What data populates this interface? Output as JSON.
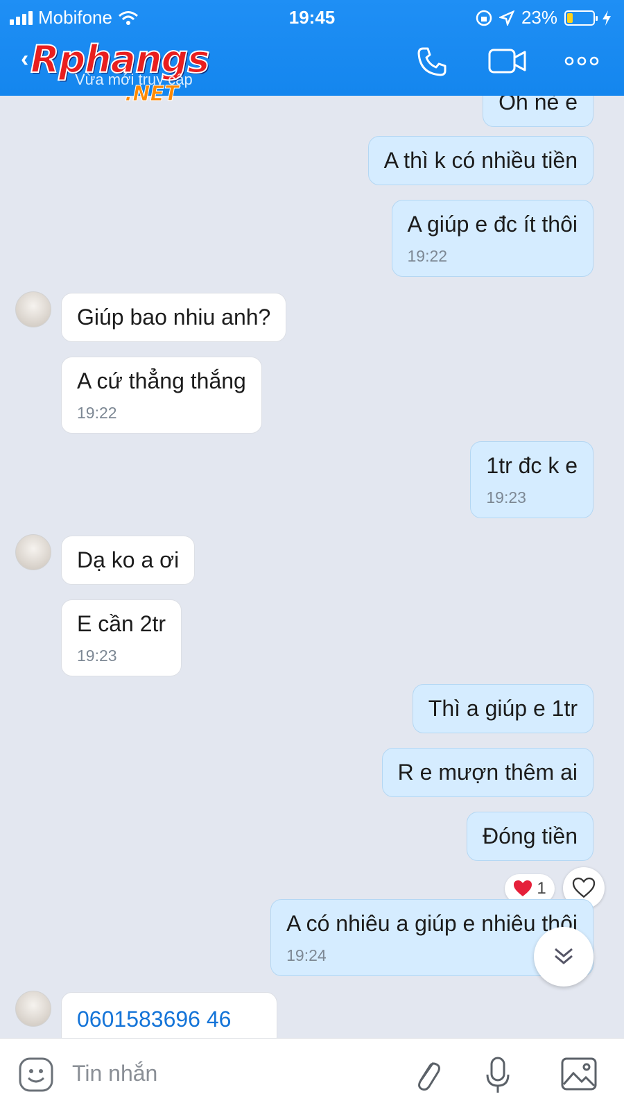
{
  "status_bar": {
    "carrier": "Mobifone",
    "time": "19:45",
    "battery": "23%",
    "battery_level": 0.23
  },
  "header": {
    "logo": "Rphangs",
    "logo_suffix": ".NET",
    "subtitle": "Vừa mới truy cập"
  },
  "messages": {
    "m0": {
      "text": "Oh nè e"
    },
    "m1": {
      "text": "A thì k có nhiều tiền"
    },
    "m2": {
      "text": "A giúp e đc ít thôi",
      "time": "19:22"
    },
    "m3": {
      "text": "Giúp bao nhiu anh?"
    },
    "m4": {
      "text": "A cứ thẳng thắng",
      "time": "19:22"
    },
    "m5": {
      "text": "1tr đc k e",
      "time": "19:23"
    },
    "m6": {
      "text": "Dạ ko a ơi"
    },
    "m7": {
      "text": "E cần 2tr",
      "time": "19:23"
    },
    "m8": {
      "text": "Thì a giúp e 1tr"
    },
    "m9": {
      "text": "R e mượn thêm ai"
    },
    "m10": {
      "text": "Đóng tiền",
      "reaction_count": "1"
    },
    "m11": {
      "text": "A có nhiêu a giúp e nhiêu thôi",
      "time": "19:24"
    },
    "m12": {
      "text": "0601583696 46"
    }
  },
  "input": {
    "placeholder": "Tin nhắn"
  },
  "colors": {
    "header": "#1486ee",
    "out_bubble": "#d5ecff",
    "in_bubble": "#ffffff",
    "chat_bg": "#e3e7f0"
  }
}
